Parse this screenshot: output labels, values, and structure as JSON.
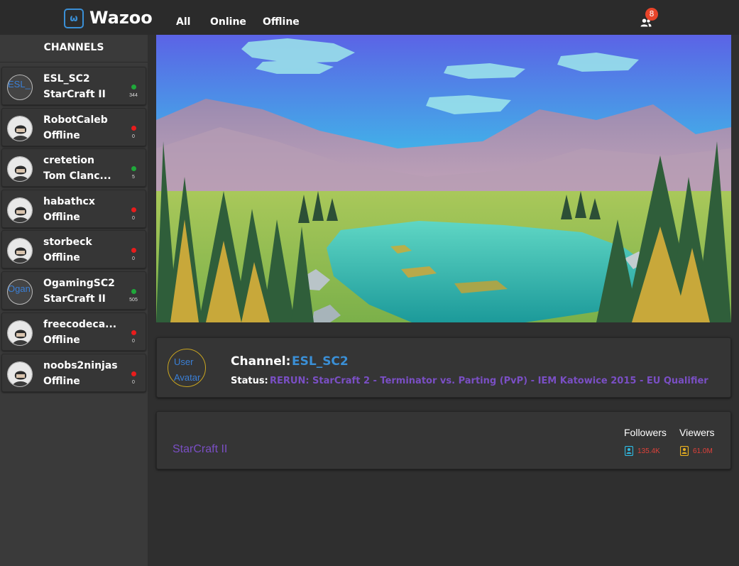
{
  "header": {
    "logo_letter": "ω",
    "brand": "Wazoo",
    "nav": [
      "All",
      "Online",
      "Offline"
    ],
    "friends_icon": "friends-icon",
    "notification_count": "8"
  },
  "sidebar": {
    "title": "CHANNELS",
    "channels": [
      {
        "name": "ESL_SC2",
        "game": "StarCraft II",
        "status": "online",
        "count": "344",
        "avatar_text": "ESL_"
      },
      {
        "name": "RobotCaleb",
        "game": "Offline",
        "status": "offline",
        "count": "0",
        "avatar_text": ""
      },
      {
        "name": "cretetion",
        "game": "Tom Clanc...",
        "status": "online",
        "count": "5",
        "avatar_text": ""
      },
      {
        "name": "habathcx",
        "game": "Offline",
        "status": "offline",
        "count": "0",
        "avatar_text": ""
      },
      {
        "name": "storbeck",
        "game": "Offline",
        "status": "offline",
        "count": "0",
        "avatar_text": ""
      },
      {
        "name": "OgamingSC2",
        "game": "StarCraft II",
        "status": "online",
        "count": "505",
        "avatar_text": "Ogan"
      },
      {
        "name": "freecodeca...",
        "game": "Offline",
        "status": "offline",
        "count": "0",
        "avatar_text": ""
      },
      {
        "name": "noobs2ninjas",
        "game": "Offline",
        "status": "offline",
        "count": "0",
        "avatar_text": ""
      }
    ]
  },
  "info": {
    "avatar_line1": "User",
    "avatar_line2": "Avatar",
    "channel_label": "Channel:",
    "channel_value": "ESL_SC2",
    "status_label": "Status:",
    "status_value": "RERUN: StarCraft 2 - Terminator vs. Parting (PvP) - IEM Katowice 2015 - EU Qualifier"
  },
  "stats": {
    "game": "StarCraft II",
    "followers_label": "Followers",
    "followers_value": "135.4K",
    "viewers_label": "Viewers",
    "viewers_value": "61.0M"
  },
  "colors": {
    "accent_blue": "#3a8fd6",
    "purple": "#7a4fc4",
    "online": "#1fa83a",
    "offline": "#e81c1c",
    "badge": "#e8442a"
  }
}
